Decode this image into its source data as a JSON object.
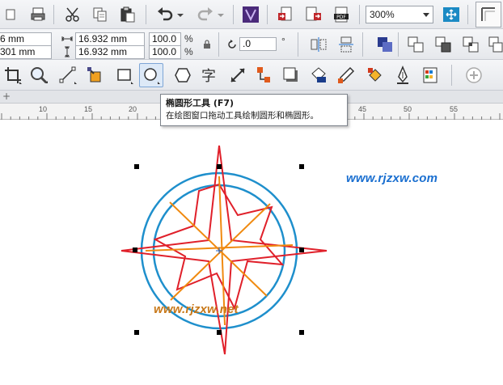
{
  "toolbar_standard": {
    "zoom_level": "300%",
    "icons": [
      "cut-icon",
      "copy-icon",
      "paste-icon",
      "undo-icon",
      "redo-icon",
      "corel-connect-icon",
      "import-icon",
      "export-icon",
      "pdf-icon",
      "full-screen-preview-icon",
      "snap-to-icon"
    ]
  },
  "property_bar": {
    "position_x_partial": "6 mm",
    "position_y_partial": "301 mm",
    "width_value": "16.932 mm",
    "height_value": "16.932 mm",
    "scale_x": "100.0",
    "scale_y": "100.0",
    "percent_sign": "%",
    "rotation": ".0",
    "degree_sign": "°"
  },
  "toolbox": {
    "selected_tool": "ellipse-tool",
    "tools": [
      "crop-tool",
      "zoom-tool",
      "freehand-tool",
      "smart-fill-tool",
      "rectangle-tool",
      "ellipse-tool",
      "polygon-tool",
      "text-tool",
      "dimension-tool",
      "connector-tool",
      "drop-shadow-tool",
      "transparency-tool",
      "color-eyedropper-tool",
      "interactive-fill-tool",
      "smart-fill-pen-tool",
      "outline-tool",
      "add-tool"
    ]
  },
  "ruler": {
    "ticks": [
      "10",
      "15",
      "20",
      "45",
      "50",
      "55"
    ]
  },
  "tooltip": {
    "title": "椭圆形工具 (F7)",
    "description": "在绘图窗口拖动工具绘制圆形和椭圆形。"
  },
  "canvas": {
    "watermark_top": "www.rjzxw.com",
    "watermark_bottom": "www.rjzxw.net",
    "colors": {
      "circle": "#1e8fcc",
      "star_outer": "#e0202a",
      "lines_inner": "#f08a10",
      "watermark_top": "#1a6fd0",
      "watermark_bottom": "#c87818"
    }
  }
}
